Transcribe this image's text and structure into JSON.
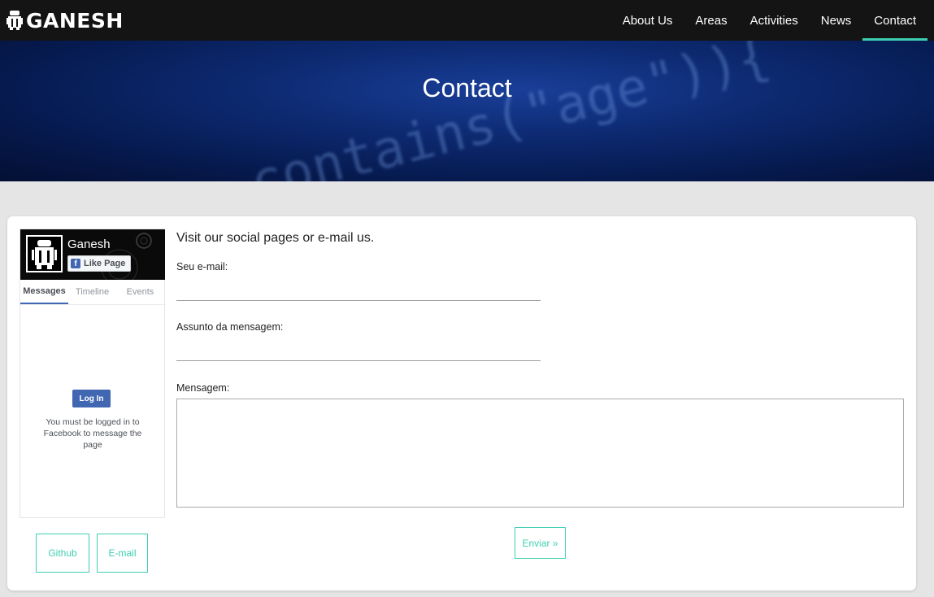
{
  "brand": {
    "name": "GANESH",
    "logo_icon": "ganesh-robot-logo"
  },
  "nav": {
    "items": [
      {
        "label": "About Us"
      },
      {
        "label": "Areas"
      },
      {
        "label": "Activities"
      },
      {
        "label": "News"
      },
      {
        "label": "Contact",
        "active": true
      }
    ]
  },
  "hero": {
    "title": "Contact",
    "background_code": "contains(\"age\")){"
  },
  "facebook": {
    "page_name": "Ganesh",
    "like_label": "Like Page",
    "tabs": [
      {
        "label": "Messages",
        "active": true
      },
      {
        "label": "Timeline"
      },
      {
        "label": "Events"
      }
    ],
    "login_label": "Log In",
    "message": "You must be logged in to Facebook to message the page",
    "brand_color": "#4267b2"
  },
  "social": {
    "github_label": "Github",
    "email_label": "E-mail"
  },
  "form": {
    "intro": "Visit our social pages or e-mail us.",
    "email_label": "Seu e-mail:",
    "email_value": "",
    "subject_label": "Assunto da mensagem:",
    "subject_value": "",
    "message_label": "Mensagem:",
    "message_value": "",
    "submit_label": "Enviar »"
  },
  "colors": {
    "accent": "#3ecfb2",
    "navbar": "#141414",
    "page_bg": "#e5e5e5"
  }
}
